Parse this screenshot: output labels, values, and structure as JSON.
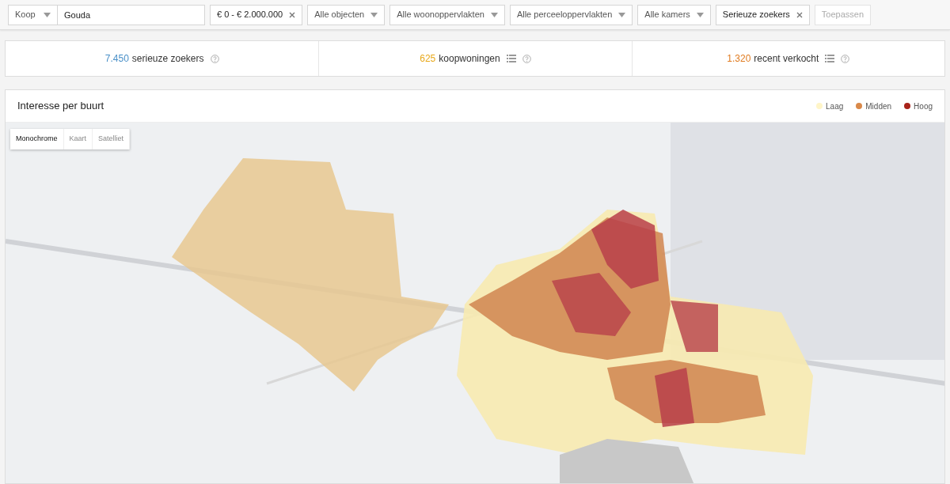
{
  "filters": [
    {
      "kind": "select",
      "value": "Koop"
    },
    {
      "kind": "input",
      "value": "Gouda"
    },
    {
      "kind": "chip",
      "value": "€ 0 - € 2.000.000"
    },
    {
      "kind": "select",
      "value": "Alle objecten"
    },
    {
      "kind": "select",
      "value": "Alle woonoppervlakten"
    },
    {
      "kind": "select",
      "value": "Alle perceeloppervlakten"
    },
    {
      "kind": "select",
      "value": "Alle kamers"
    },
    {
      "kind": "chip",
      "value": "Serieuze zoekers"
    },
    {
      "kind": "button",
      "value": "Toepassen",
      "disabled": true
    }
  ],
  "stats": [
    {
      "number": "7.450",
      "label": "serieuze zoekers",
      "color": "#4a90c8",
      "list_icon": false
    },
    {
      "number": "625",
      "label": "koopwoningen",
      "color": "#e8a81a",
      "list_icon": true
    },
    {
      "number": "1.320",
      "label": "recent verkocht",
      "color": "#e07b20",
      "list_icon": true
    }
  ],
  "map_panel": {
    "title": "Interesse per buurt",
    "legend": [
      {
        "label": "Laag",
        "color": "#fff5c8"
      },
      {
        "label": "Midden",
        "color": "#d9894a"
      },
      {
        "label": "Hoog",
        "color": "#a8231a"
      }
    ],
    "map_types": [
      {
        "label": "Monochrome",
        "selected": true
      },
      {
        "label": "Kaart",
        "selected": false
      },
      {
        "label": "Satelliet",
        "selected": false
      }
    ]
  }
}
